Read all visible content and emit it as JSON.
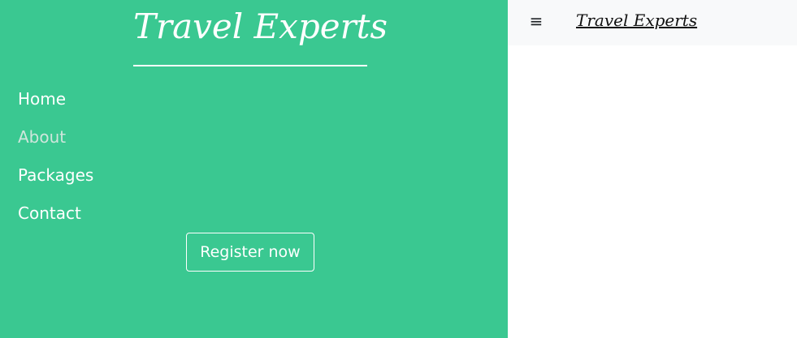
{
  "sidebar": {
    "title": "Travel Experts",
    "nav": [
      {
        "label": "Home",
        "active": false
      },
      {
        "label": "About",
        "active": true
      },
      {
        "label": "Packages",
        "active": false
      },
      {
        "label": "Contact",
        "active": false
      }
    ],
    "cta_label": "Register now"
  },
  "topbar": {
    "menu_icon": "menu-icon",
    "menu_glyph": "≡",
    "brand": "Travel Experts"
  },
  "colors": {
    "sidebar_bg": "#3ac891",
    "text_light": "#ffffff",
    "nav_muted": "#cfe6dc",
    "topbar_bg": "#f8f9fa",
    "topbar_text": "#111111"
  }
}
